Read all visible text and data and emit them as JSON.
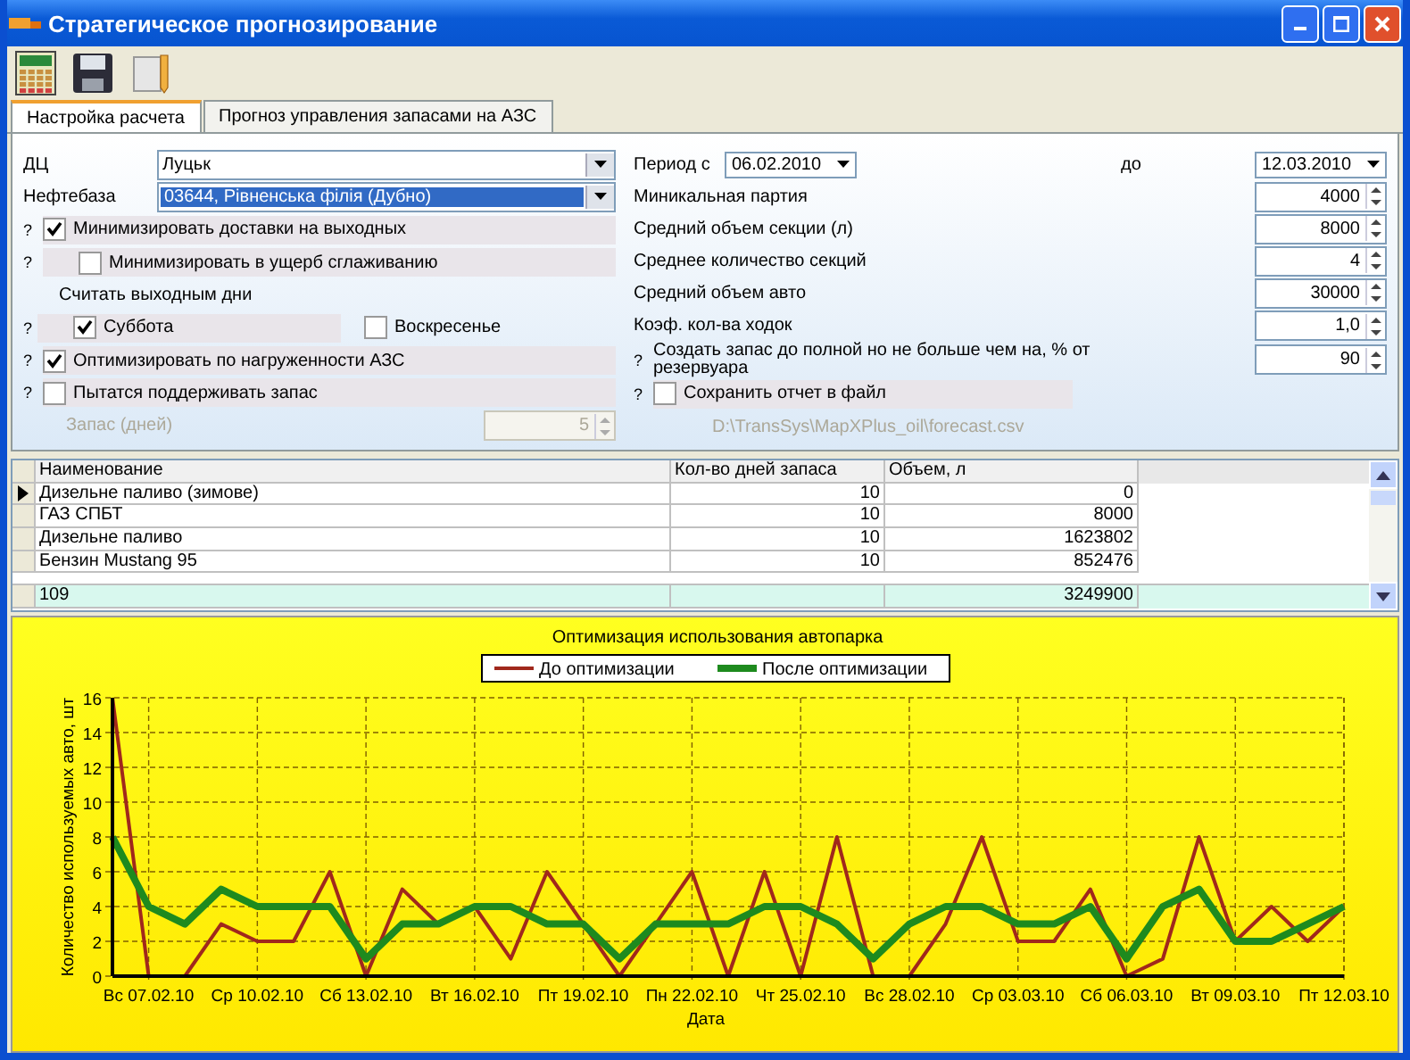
{
  "window": {
    "title": "Стратегическое прогнозирование"
  },
  "tabs": [
    {
      "label": "Настройка расчета",
      "selected": true
    },
    {
      "label": "Прогноз управления запасами на АЗС",
      "selected": false
    }
  ],
  "left_rows": [
    {
      "kind": "combo",
      "label": "ДЦ",
      "value": "Луцьк",
      "selected": false
    },
    {
      "kind": "combo",
      "label": "Нефтебаза",
      "value": "03644, Рівненська філія (Дубно)",
      "selected": true
    },
    {
      "kind": "check",
      "help": "?",
      "label": "Минимизировать доставки на выходных",
      "checked": true,
      "nested": false
    },
    {
      "kind": "check",
      "help": "?",
      "label": "Минимизировать в ущерб сглаживанию",
      "checked": false,
      "nested": true
    },
    {
      "kind": "heading",
      "label": "Считать выходным дни"
    },
    {
      "kind": "check_pair",
      "help": "?",
      "items": [
        {
          "label": "Суббота",
          "checked": true
        },
        {
          "label": "Воскресенье",
          "checked": false
        }
      ]
    },
    {
      "kind": "check",
      "help": "?",
      "label": "Оптимизировать по нагруженности АЗС",
      "checked": true,
      "nested": false
    },
    {
      "kind": "check",
      "help": "?",
      "label": "Пытатся поддерживать запас",
      "checked": false,
      "nested": false
    },
    {
      "kind": "spin",
      "label": "Запас (дней)",
      "value": "5",
      "disabled": true
    }
  ],
  "right_rows": [
    {
      "kind": "period",
      "label": "Период с",
      "from": "06.02.2010",
      "to_label": "до",
      "to": "12.03.2010"
    },
    {
      "kind": "spin",
      "label": "Миникальная партия",
      "value": "4000"
    },
    {
      "kind": "spin",
      "label": "Средний объем секции (л)",
      "value": "8000"
    },
    {
      "kind": "spin",
      "label": "Среднее количество секций",
      "value": "4"
    },
    {
      "kind": "spin",
      "label": "Средний объем авто",
      "value": "30000"
    },
    {
      "kind": "spin",
      "label": "Коэф. кол-ва ходок",
      "value": "1,0"
    },
    {
      "kind": "spin",
      "help": "?",
      "label": "Создать запас до полной но не больше чем на, % от резервуара",
      "value": "90"
    },
    {
      "kind": "check",
      "help": "?",
      "label": "Сохранить отчет в файл",
      "checked": false
    },
    {
      "kind": "path",
      "label": "D:\\TransSys\\MapXPlus_oil\\forecast.csv"
    }
  ],
  "table": {
    "columns": [
      "Наименование",
      "Кол-во дней запаса",
      "Объем, л"
    ],
    "rows": [
      {
        "name": "Дизельне паливо (зимове)",
        "days": "10",
        "volume": "0",
        "selected": true
      },
      {
        "name": "ГАЗ СПБТ",
        "days": "10",
        "volume": "8000",
        "selected": false
      },
      {
        "name": "Дизельне паливо",
        "days": "10",
        "volume": "1623802",
        "selected": false
      },
      {
        "name": "Бензин Mustang 95",
        "days": "10",
        "volume": "852476",
        "selected": false
      }
    ],
    "total": {
      "name": "109",
      "volume": "3249900"
    }
  },
  "chart": {
    "chart_data": {
      "type": "line",
      "title": "Оптимизация использования автопарка",
      "xlabel": "Дата",
      "ylabel": "Количество используемых авто, шт",
      "categories": [
        null,
        "Вс 07.02.10",
        null,
        null,
        "Ср 10.02.10",
        null,
        null,
        "Сб 13.02.10",
        null,
        null,
        "Вт 16.02.10",
        null,
        null,
        "Пт 19.02.10",
        null,
        null,
        "Пн 22.02.10",
        null,
        null,
        "Чт 25.02.10",
        null,
        null,
        "Вс 28.02.10",
        null,
        null,
        "Ср 03.03.10",
        null,
        null,
        "Сб 06.03.10",
        null,
        null,
        "Вт 09.03.10",
        null,
        null,
        "Пт 12.03.10"
      ],
      "ylim": [
        0,
        16
      ],
      "grid": true,
      "legend": "top",
      "yticks": [
        0,
        2,
        4,
        6,
        8,
        10,
        12,
        14,
        16
      ],
      "series": [
        {
          "name": "До оптимизации",
          "color": "#a0281c",
          "values": [
            16,
            0,
            0,
            3,
            2,
            2,
            6,
            0,
            5,
            3,
            4,
            1,
            6,
            3,
            0,
            3,
            6,
            0,
            6,
            0,
            8,
            0,
            0,
            3,
            8,
            2,
            2,
            5,
            0,
            1,
            8,
            2,
            4,
            2,
            4
          ]
        },
        {
          "name": "После оптимизации",
          "color": "#1e8a1e",
          "values": [
            8,
            4,
            3,
            5,
            4,
            4,
            4,
            1,
            3,
            3,
            4,
            4,
            3,
            3,
            1,
            3,
            3,
            3,
            4,
            4,
            3,
            1,
            3,
            4,
            4,
            3,
            3,
            4,
            1,
            4,
            5,
            2,
            2,
            3,
            4
          ]
        }
      ]
    }
  }
}
